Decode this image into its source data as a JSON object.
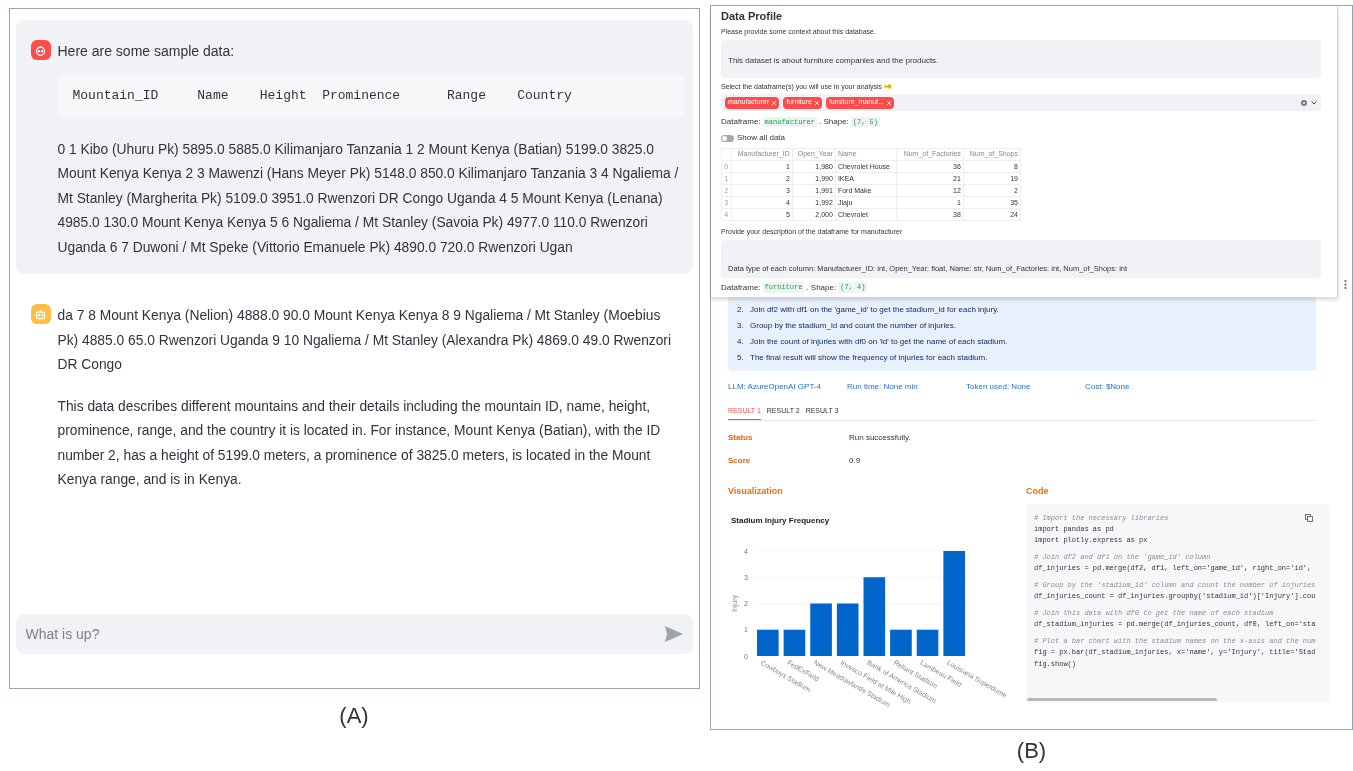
{
  "chat_panel": {
    "messages": [
      {
        "kind": "user",
        "intro": "Here are some sample data:",
        "table_header": "Mountain_ID     Name    Height  Prominence      Range    Country",
        "paragraphs": [
          "0 1 Kibo (Uhuru Pk) 5895.0 5885.0 Kilimanjaro Tanzania 1 2 Mount Kenya (Batian) 5199.0 3825.0 Mount Kenya Kenya 2 3 Mawenzi (Hans Meyer Pk) 5148.0 850.0 Kilimanjaro Tanzania 3 4 Ngaliema / Mt Stanley (Margherita Pk) 5109.0 3951.0 Rwenzori DR Congo Uganda 4 5 Mount Kenya (Lenana) 4985.0 130.0 Mount Kenya Kenya 5 6 Ngaliema / Mt Stanley (Savoia Pk) 4977.0 110.0 Rwenzori Uganda 6 7 Duwoni / Mt Speke (Vittorio Emanuele Pk) 4890.0 720.0 Rwenzori Ugan"
        ]
      },
      {
        "kind": "assistant",
        "paragraphs": [
          "da 7 8 Mount Kenya (Nelion) 4888.0 90.0 Mount Kenya Kenya 8 9 Ngaliema / Mt Stanley (Moebius Pk) 4885.0 65.0 Rwenzori Uganda 9 10 Ngaliema / Mt Stanley (Alexandra Pk) 4869.0 49.0 Rwenzori DR Congo",
          "This data describes different mountains and their details including the mountain ID, name, height, prominence, range, and the country it is located in. For instance, Mount Kenya (Batian), with the ID number 2, has a height of 5199.0 meters, a prominence of 3825.0 meters, is located in the Mount Kenya range, and is in Kenya."
        ]
      }
    ],
    "input": {
      "placeholder": "What is up?"
    }
  },
  "data_panel": {
    "profile": {
      "title": "Data Profile",
      "context_label": "Please provide some context about this database.",
      "context_value": "This dataset is about furniture companies and the products.",
      "select_label": "Select the dataframe(s) you will use in your analysis",
      "tags": [
        "manufacturer",
        "furniture",
        "furniture_manuf..."
      ],
      "dataframe": {
        "label": "Dataframe:",
        "name": "manufacturer",
        "shape_label": ". Shape:",
        "shape": "(7, 5)"
      },
      "show_all": {
        "label": "Show all data",
        "on": false
      },
      "table": {
        "columns": [
          {
            "kind": "index"
          },
          {
            "kind": "number",
            "label": "Manufacturer_ID"
          },
          {
            "kind": "number",
            "label": "Open_Year"
          },
          {
            "kind": "text",
            "label": "Name"
          },
          {
            "kind": "number",
            "label": "Num_of_Factories"
          },
          {
            "kind": "number",
            "label": "Num_of_Shops"
          }
        ],
        "rows": [
          [
            "0",
            "1",
            "1,980",
            "Chevrolet House",
            "36",
            "8"
          ],
          [
            "1",
            "2",
            "1,990",
            "IKEA",
            "21",
            "19"
          ],
          [
            "2",
            "3",
            "1,991",
            "Ford Make",
            "12",
            "2"
          ],
          [
            "3",
            "4",
            "1,992",
            "Jiaju",
            "1",
            "35"
          ],
          [
            "4",
            "5",
            "2,000",
            "Chevrolet",
            "38",
            "24"
          ]
        ]
      },
      "description_label": "Provide your description of the dataframe for manufacturer",
      "description_value": "Data type of each column: Manufacturer_ID: int, Open_Year: float, Name: str, Num_of_Factories: int, Num_of_Shops: int",
      "dataframe_2": {
        "label": "Dataframe:",
        "name": "furniture",
        "shape_label": ". Shape:",
        "shape": "(7, 4)"
      }
    },
    "result": {
      "steps": [
        {
          "number": "2.",
          "text": "Join df2 with df1 on the 'game_id' to get the stadium_id for each injury."
        },
        {
          "number": "3.",
          "text": "Group by the stadium_id and count the number of injuries."
        },
        {
          "number": "4.",
          "text": "Join the count of injuries with df0 on 'id' to get the name of each stadium."
        },
        {
          "number": "5.",
          "text": "The final result will show the frequency of injuries for each stadium."
        }
      ],
      "metrics": [
        "LLM: AzureOpenAI GPT-4",
        "Run time: None min",
        "Token used: None",
        "Cost: $None"
      ],
      "tabs": [
        {
          "label": "RESULT 1",
          "selected": true
        },
        {
          "label": "RESULT 2",
          "selected": false
        },
        {
          "label": "RESULT 3",
          "selected": false
        }
      ],
      "fields": [
        {
          "label": "Status",
          "value": "Run successfully."
        },
        {
          "label": "Score",
          "value": "0.9"
        }
      ],
      "visualization_title": "Visualization",
      "code_title": "Code",
      "chart_data": {
        "type": "bar",
        "title": "Stadium Injury Frequency",
        "ylabel": "Injury",
        "categories": [
          "Cowboys Stadium",
          "FedExField",
          "New Meadowlands Stadium",
          "Invesco Field at Mile High",
          "Bank of America Stadium",
          "Reliant Stadium",
          "Lambeau Field",
          "Louisiana Superdome"
        ],
        "series": [
          {
            "color": "#0066cc",
            "values": [
              1,
              1,
              2,
              2,
              3,
              1,
              1,
              4
            ]
          }
        ],
        "yticks": [
          0,
          1,
          2,
          3,
          4
        ],
        "ylim": [
          0,
          4
        ],
        "grid": true
      },
      "code_blocks": [
        [
          {
            "kind": "comment",
            "text": "# Import the necessary libraries"
          },
          {
            "kind": "code",
            "text": "import pandas as pd"
          },
          {
            "kind": "code",
            "text": "import plotly.express as px"
          }
        ],
        [
          {
            "kind": "comment",
            "text": "# Join df2 and df1 on the 'game_id' column"
          },
          {
            "kind": "code",
            "text": "df_injuries = pd.merge(df2, df1, left_on='game_id', right_on='id',"
          }
        ],
        [
          {
            "kind": "comment",
            "text": "# Group by the 'stadium_id' column and count the number of injuries"
          },
          {
            "kind": "code",
            "text": "df_injuries_count = df_injuries.groupby('stadium_id')['Injury'].cou"
          }
        ],
        [
          {
            "kind": "comment",
            "text": "# Join this data with df0 to get the name of each stadium"
          },
          {
            "kind": "code",
            "text": "df_stadium_injuries = pd.merge(df_injuries_count, df0, left_on='sta"
          }
        ],
        [
          {
            "kind": "comment",
            "text": "# Plot a bar chart with the stadium names on the x-axis and the num"
          },
          {
            "kind": "code",
            "text": "fig = px.bar(df_stadium_injuries, x='name', y='Injury', title='Stad"
          },
          {
            "kind": "code",
            "text": "fig.show()"
          }
        ]
      ]
    }
  },
  "captions": [
    "(A)",
    "(B)"
  ]
}
